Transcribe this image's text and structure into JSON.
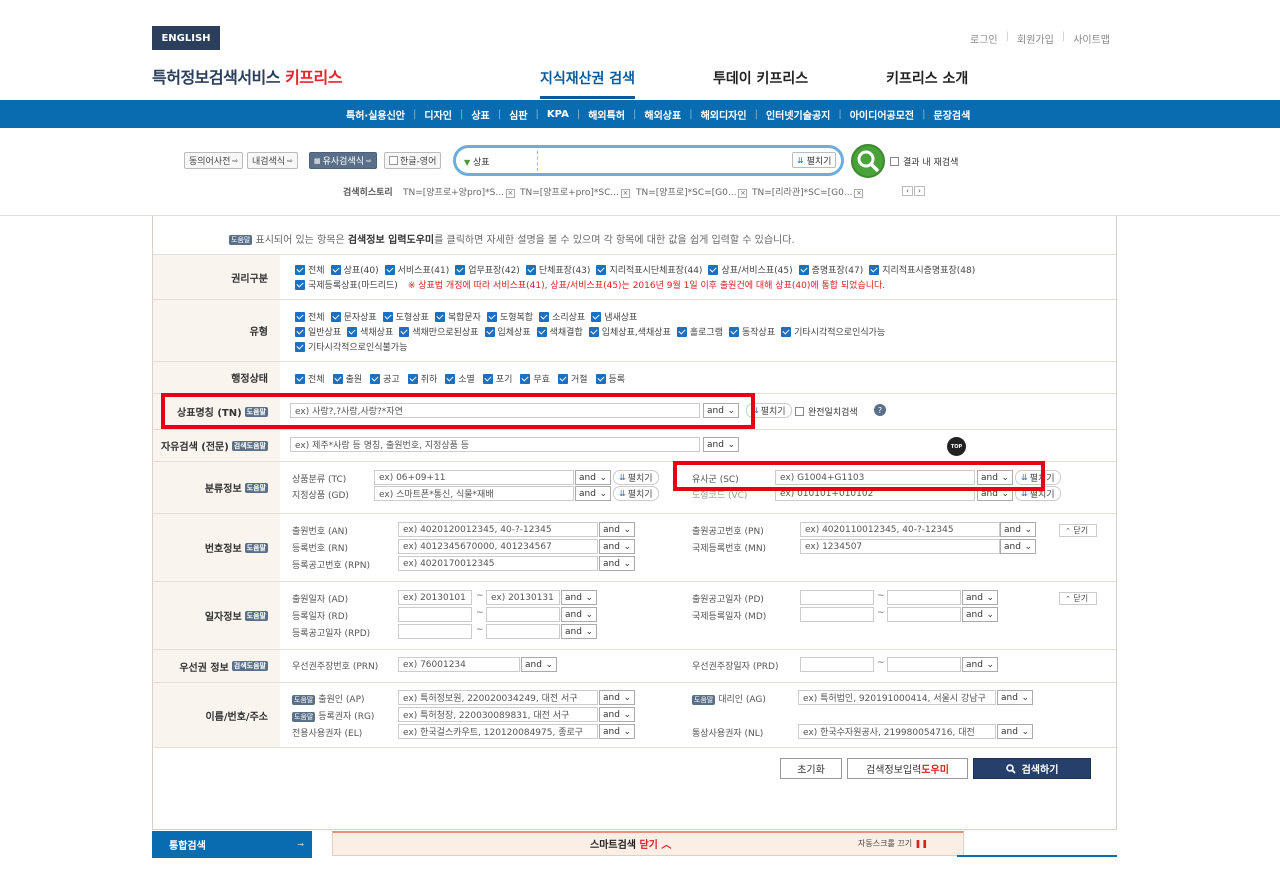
{
  "header": {
    "english": "ENGLISH",
    "links": [
      "로그인",
      "회원가입",
      "사이트맵"
    ],
    "logo_main": "특허정보검색서비스 ",
    "logo_accent": "키프리스",
    "nav": [
      "지식재산권 검색",
      "투데이 키프리스",
      "키프리스 소개"
    ]
  },
  "subnav": [
    "특허·실용신안",
    "디자인",
    "상표",
    "심판",
    "KPA",
    "해외특허",
    "해외상표",
    "해외디자인",
    "인터넷기술공지",
    "아이디어공모전",
    "문장검색"
  ],
  "toolbar": {
    "synonym": "동의어사전",
    "internal": "내검색식",
    "similar": "유사검색식",
    "hangul": "한글-영어",
    "search_select": "상표",
    "expand": "펼치기",
    "result_research": "결과 내 재검색"
  },
  "history": {
    "label": "검색히스토리",
    "items": [
      "TN=[양프로+양pro]*S...",
      "TN=[양프로+pro]*SC...",
      "TN=[양프로]*SC=[G0...",
      "TN=[리라관]*SC=[G0..."
    ]
  },
  "info": {
    "badge": "도움말",
    "pre": " 표시되어 있는 항목은 ",
    "bold": "검색정보 입력도우미",
    "post": "를 클릭하면 자세한 설명을 볼 수 있으며 각 항목에 대한 값을 쉽게 입력할 수 있습니다."
  },
  "rights": {
    "label": "권리구분",
    "line1": [
      "전체",
      "상표(40)",
      "서비스표(41)",
      "업무표장(42)",
      "단체표장(43)",
      "지리적표시단체표장(44)",
      "상표/서비스표(45)",
      "증명표장(47)",
      "지리적표시증명표장(48)"
    ],
    "line2": [
      "국제등록상표(마드리드)"
    ],
    "notice": "※ 상표법 개정에 따라 서비스표(41), 상표/서비스표(45)는 2016년 9월 1일 이후 출원건에 대해 상표(40)에 통합 되었습니다."
  },
  "types": {
    "label": "유형",
    "line1": [
      "전체",
      "문자상표",
      "도형상표",
      "복합문자",
      "도형복합",
      "소리상표",
      "냄새상표"
    ],
    "line2": [
      "일반상표",
      "색채상표",
      "색채만으로된상표",
      "입체상표",
      "색채결합",
      "입체상표,색채상표",
      "홀로그램",
      "동작상표",
      "기타시각적으로인식가능"
    ],
    "line3": [
      "기타시각적으로인식불가능"
    ]
  },
  "status": {
    "label": "행정상태",
    "items": [
      "전체",
      "출원",
      "공고",
      "취하",
      "소멸",
      "포기",
      "무효",
      "거절",
      "등록"
    ]
  },
  "tn": {
    "label": "상표명칭 (TN)",
    "badge": "도움말",
    "placeholder": "ex) 사랑?,?사랑,사랑?*자연",
    "and": "and",
    "expand": "펼치기",
    "exact": "완전일치검색",
    "help": "?"
  },
  "free": {
    "label": "자유검색 (전문)",
    "badge": "검색도움말",
    "placeholder": "ex) 제주*사랑 등 명칭, 출원번호, 지정상품 등",
    "and": "and"
  },
  "class": {
    "label": "분류정보",
    "badge": "도움말",
    "tc_label": "상품분류 (TC)",
    "tc": "ex) 06+09+11",
    "gd_label": "지정상품 (GD)",
    "gd": "ex) 스마트폰*통신, 식물*재배",
    "sc_label": "유사군 (SC)",
    "sc": "ex) G1004+G1103",
    "vc_label": "도형코드 (VC)",
    "vc": "ex) 010101+010102",
    "and": "and",
    "expand": "펼치기"
  },
  "numbers": {
    "label": "번호정보",
    "badge": "도움말",
    "an_label": "출원번호 (AN)",
    "an": "ex) 4020120012345, 40-?-12345",
    "rn_label": "등록번호 (RN)",
    "rn": "ex) 4012345670000, 401234567",
    "rpn_label": "등록공고번호 (RPN)",
    "rpn": "ex) 4020170012345",
    "pn_label": "출원공고번호 (PN)",
    "pn": "ex) 4020110012345, 40-?-12345",
    "mn_label": "국제등록번호 (MN)",
    "mn": "ex) 1234507",
    "and": "and",
    "close": "닫기"
  },
  "dates": {
    "label": "일자정보",
    "badge": "도움말",
    "ad_label": "출원일자 (AD)",
    "ad_from": "ex) 20130101",
    "ad_to": "ex) 20130131",
    "rd_label": "등록일자 (RD)",
    "rpd_label": "등록공고일자 (RPD)",
    "pd_label": "출원공고일자 (PD)",
    "md_label": "국제등록일자 (MD)",
    "and": "and",
    "close": "닫기",
    "tilde": "~"
  },
  "priority": {
    "label": "우선권 정보",
    "badge": "검색도움말",
    "prn_label": "우선권주장번호 (PRN)",
    "prn": "ex) 76001234",
    "prd_label": "우선권주장일자 (PRD)",
    "and": "and",
    "tilde": "~"
  },
  "names": {
    "label": "이름/번호/주소",
    "badge": "도움말",
    "ap_label": "출원인 (AP)",
    "ap": "ex) 특허정보원, 220020034249, 대전 서구",
    "rg_label": "등록권자 (RG)",
    "rg": "ex) 특허청장, 220030089831, 대전 서구",
    "el_label": "전용사용권자 (EL)",
    "el": "ex) 한국걸스카우트, 120120084975, 종로구",
    "ag_label": "대리인 (AG)",
    "ag": "ex) 특허법인, 920191000414, 서울시 강남구",
    "nl_label": "통상사용권자 (NL)",
    "nl": "ex) 한국수자원공사, 219980054716, 대전",
    "and": "and"
  },
  "buttons": {
    "reset": "초기화",
    "helper_pre": "검색정보입력",
    "helper_accent": "도우미",
    "search": "검색하기"
  },
  "top_icon": "TOP",
  "bottom": {
    "left": "통합검색",
    "smart_pre": "스마트검색 ",
    "smart_accent": "닫기",
    "autoscroll": "자동스크롤 끄기"
  }
}
